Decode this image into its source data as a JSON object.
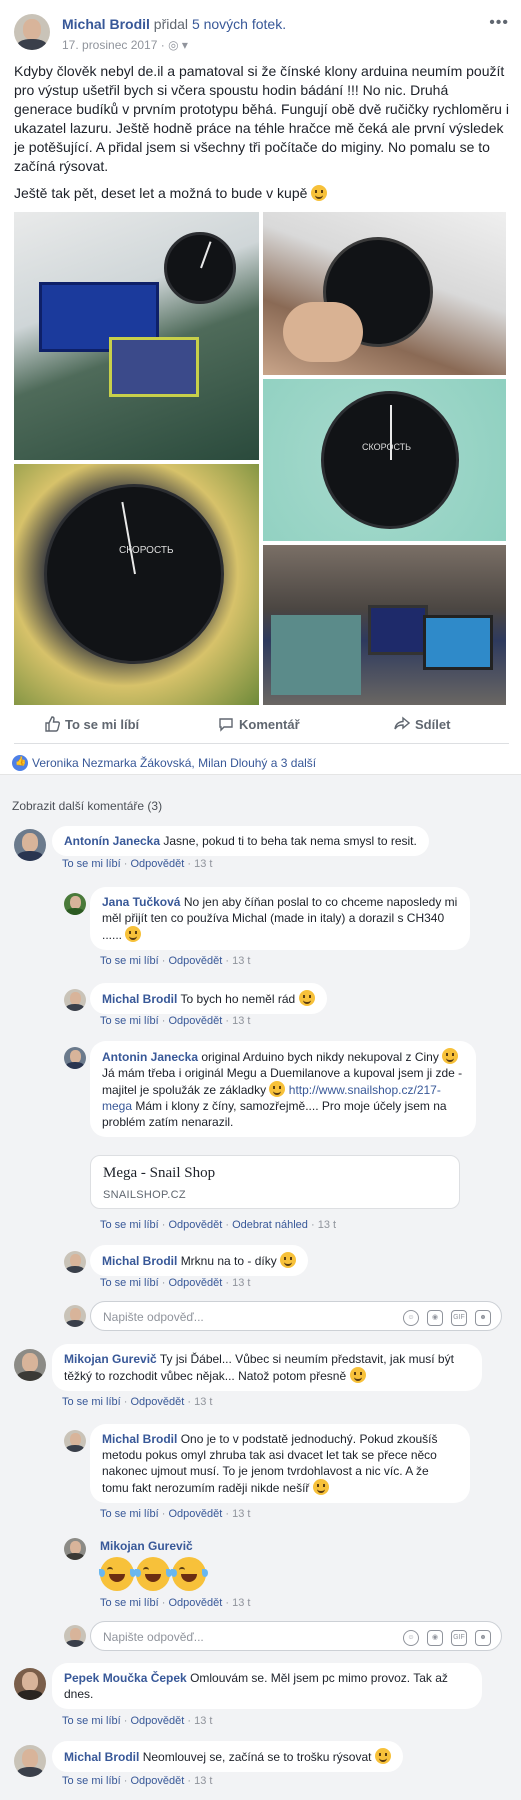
{
  "post": {
    "author": "Michal Brodil",
    "action": "přidal",
    "action_link": "5 nových fotek.",
    "date": "17. prosinec 2017 · ",
    "text_p1": "Kdyby člověk nebyl de.il a pamatoval si že čínské klony arduina neumím použít pro výstup ušetřil bych si včera spoustu hodin bádání !!! No nic. Druhá generace budíků v prvním prototypu běhá. Fungují obě dvě ručičky rychloměru i ukazatel lazuru. Ještě hodně práce na téhle hračce mě čeká ale první výsledek je potěšující. A přidal jsem si všechny tři počítače do miginy. No pomalu se to začíná rýsovat.",
    "text_p2": "Ještě tak pět, deset let a možná to bude v kupě",
    "photo_captions": {
      "dial_label": "СКОРОСТЬ"
    }
  },
  "actions": {
    "like": "To se mi líbí",
    "comment": "Komentář",
    "share": "Sdílet"
  },
  "reactions": "Veronika Nezmarka Žákovská, Milan Dlouhý a 3 další",
  "more_comments": "Zobrazit další komentáře (3)",
  "comments": [
    {
      "name": "Antonín Janecka",
      "text": "Jasne, pokud ti to beha tak nema smysl to resit.",
      "time": "13 t"
    },
    {
      "name": "Jana Tučková",
      "text": "No jen aby číňan poslal to co chceme naposledy mi měl přijít ten co používa Michal (made in italy) a dorazil s CH340 ......",
      "time": "13 t"
    },
    {
      "name": "Michal Brodil",
      "text": "To bych ho neměl rád",
      "time": "13 t"
    },
    {
      "name": "Antonin Janecka",
      "text1": "original Arduino bych nikdy nekupoval z Ciny",
      "text2": "Já mám třeba i originál Megu a Duemilanove a kupoval jsem ji zde - majitel je spolužák ze základky",
      "link": "http://www.snailshop.cz/217-mega",
      "text3": "Mám i klony z číny, samozřejmě.... Pro moje účely jsem na problém zatím nenarazil.",
      "preview_title": "Mega - Snail Shop",
      "preview_domain": "SNAILSHOP.CZ",
      "remove_preview": "Odebrat náhled",
      "time": "13 t"
    },
    {
      "name": "Michal Brodil",
      "text": "Mrknu na to - díky",
      "time": "13 t"
    },
    {
      "name": "Mikojan Gurevič",
      "text": "Ty jsi Ďábel... Vůbec si neumím představit, jak musí být těžký to rozchodit vůbec nějak... Natož potom přesně",
      "time": "13 t"
    },
    {
      "name": "Michal Brodil",
      "text": "Ono je to v podstatě jednoduchý. Pokud zkoušíš metodu pokus omyl zhruba tak asi dvacet let tak se přece něco nakonec ujmout musí. To je jenom tvrdohlavost a nic víc. A že tomu fakt nerozumím raději nikde nešíř",
      "time": "13 t"
    },
    {
      "name": "Mikojan Gurevič",
      "text": "",
      "time": "13 t"
    },
    {
      "name": "Pepek Moučka Čepek",
      "text": "Omlouvám se. Měl jsem pc mimo provoz. Tak až dnes.",
      "time": "13 t"
    },
    {
      "name": "Michal Brodil",
      "text": "Neomlouvej se, začíná se to trošku rýsovat",
      "time": "13 t"
    }
  ],
  "meta": {
    "like": "To se mi líbí",
    "reply": "Odpovědět",
    "sep": " · "
  },
  "reply_placeholder": "Napište odpověď...",
  "colors": {
    "link": "#385898",
    "bg_comments": "#f2f3f5",
    "like_blue": "#4e80e6"
  }
}
